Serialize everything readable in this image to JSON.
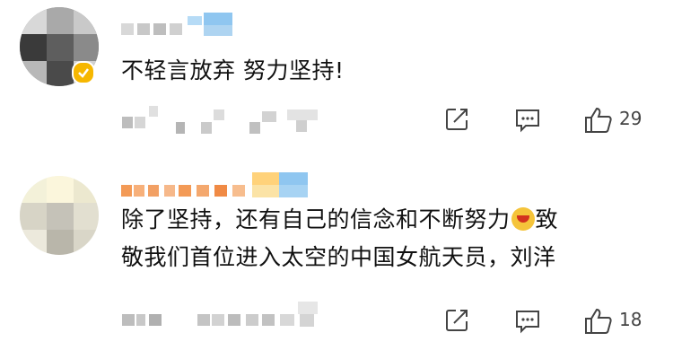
{
  "comments": [
    {
      "text_lines": [
        "不轻言放弃 努力坚持!"
      ],
      "like_count": "29",
      "verified_badge": true
    },
    {
      "text_lines": [
        "除了坚持，还有自己的信念和不断努力",
        "致",
        "敬我们首位进入太空的中国女航天员，刘洋"
      ],
      "like_count": "18",
      "emoji": "cheer-emoji"
    }
  ],
  "icons": [
    "share-icon",
    "comment-icon",
    "like-icon"
  ],
  "colors": {
    "text": "#111111",
    "icon": "#444444",
    "badge": "#f6b700",
    "blur_orange": "#f39a56",
    "blur_blue": "#8fc6f0"
  }
}
